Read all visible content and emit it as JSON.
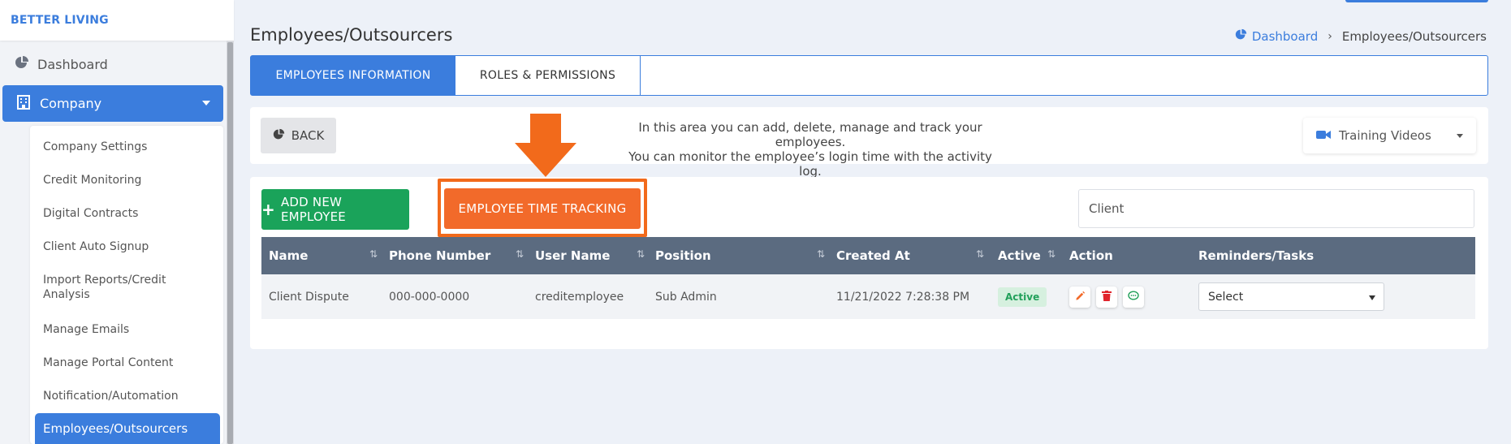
{
  "brand": "BETTER LIVING",
  "sidebar": {
    "dashboard_label": "Dashboard",
    "company_label": "Company",
    "submenu": [
      "Company Settings",
      "Credit Monitoring",
      "Digital Contracts",
      "Client Auto Signup",
      "Import Reports/Credit Analysis",
      "Manage Emails",
      "Manage Portal Content",
      "Notification/Automation"
    ],
    "active_item": "Employees/Outsourcers"
  },
  "header": {
    "title": "Employees/Outsourcers",
    "breadcrumb": {
      "home": "Dashboard",
      "current": "Employees/Outsourcers"
    }
  },
  "tabs": [
    "EMPLOYEES INFORMATION",
    "ROLES & PERMISSIONS"
  ],
  "info": {
    "back_label": "BACK",
    "line1": "In this area you can add, delete, manage and track your employees.",
    "line2": "You can monitor the employee’s login time with the activity log.",
    "training_label": "Training Videos"
  },
  "toolbar": {
    "add_label": "ADD NEW EMPLOYEE",
    "tracking_label": "EMPLOYEE TIME TRACKING",
    "client_placeholder": "Client"
  },
  "table": {
    "headers": [
      "Name",
      "Phone Number",
      "User Name",
      "Position",
      "Created At",
      "Active",
      "Action",
      "Reminders/Tasks"
    ],
    "rows": [
      {
        "name": "Client Dispute",
        "phone": "000-000-0000",
        "username": "creditemployee",
        "position": "Sub Admin",
        "created": "11/21/2022 7:28:38 PM",
        "status": "Active",
        "select": "Select"
      }
    ]
  },
  "icons": {
    "dashboard": "pie-chart-icon",
    "company": "building-icon",
    "training": "video-camera-icon",
    "edit": "pencil-icon",
    "delete": "trash-icon",
    "message": "chat-icon"
  },
  "colors": {
    "primary": "#3b7ddd",
    "success": "#1aa35a",
    "orange": "#f26a2a",
    "table_header": "#5b6b80"
  }
}
